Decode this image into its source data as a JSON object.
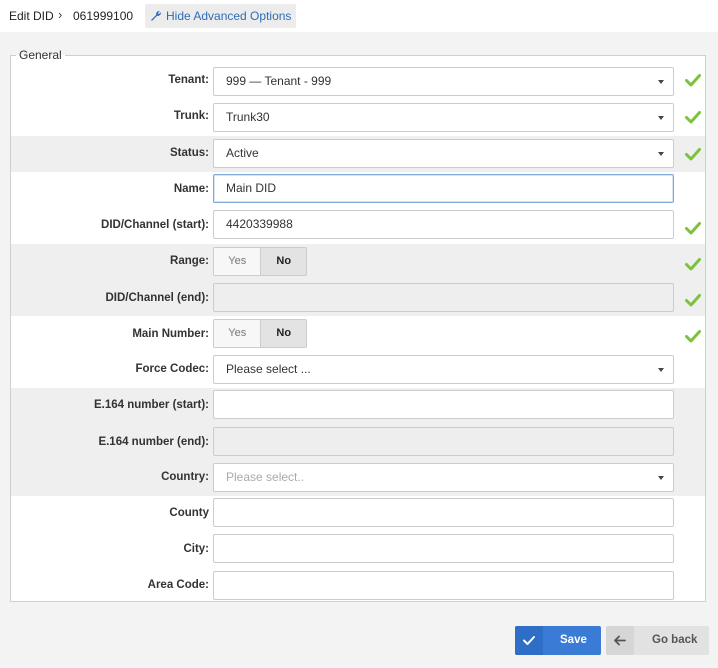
{
  "breadcrumb": {
    "edit_label": "Edit DID",
    "separator": "›",
    "record_id": "061999100"
  },
  "advanced_toggle": {
    "label": "Hide Advanced Options",
    "icon": "wrench-icon"
  },
  "fieldset": {
    "legend": "General"
  },
  "form": {
    "tenant": {
      "label": "Tenant:",
      "value": "999  —  Tenant - 999",
      "valid": true
    },
    "trunk": {
      "label": "Trunk:",
      "value": "Trunk30",
      "valid": true
    },
    "status": {
      "label": "Status:",
      "value": "Active",
      "valid": true
    },
    "name": {
      "label": "Name:",
      "value": "Main DID"
    },
    "did_start": {
      "label": "DID/Channel (start):",
      "value": "4420339988",
      "valid": true
    },
    "range": {
      "label": "Range:",
      "yes": "Yes",
      "no": "No",
      "selected": "No",
      "valid": true
    },
    "did_end": {
      "label": "DID/Channel (end):",
      "value": "",
      "valid": true
    },
    "main_number": {
      "label": "Main Number:",
      "yes": "Yes",
      "no": "No",
      "selected": "No",
      "valid": true
    },
    "force_codec": {
      "label": "Force Codec:",
      "value": "Please select ..."
    },
    "e164_start": {
      "label": "E.164 number (start):",
      "value": ""
    },
    "e164_end": {
      "label": "E.164 number (end):",
      "value": ""
    },
    "country": {
      "label": "Country:",
      "placeholder": "Please select.."
    },
    "county": {
      "label": "County",
      "value": ""
    },
    "city": {
      "label": "City:",
      "value": ""
    },
    "area_code": {
      "label": "Area Code:",
      "value": ""
    }
  },
  "actions": {
    "save": {
      "label": "Save",
      "icon": "check-icon"
    },
    "back": {
      "label": "Go back",
      "icon": "arrow-left-icon"
    }
  },
  "colors": {
    "valid_check": "#7dc23d",
    "primary": "#3a7bd5",
    "link": "#2d6db8"
  }
}
